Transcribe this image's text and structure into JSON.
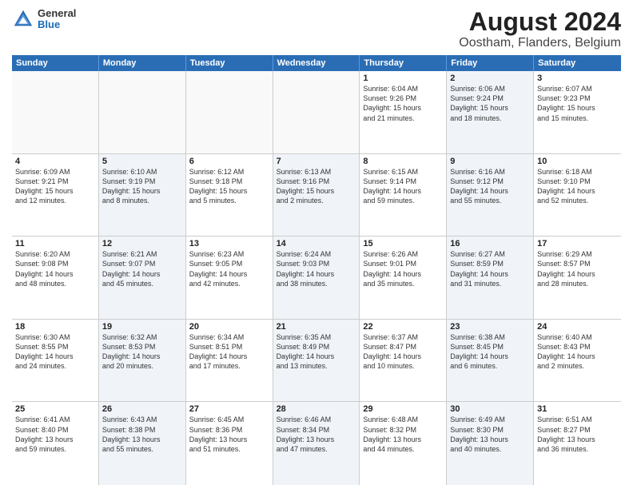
{
  "header": {
    "logo": {
      "general": "General",
      "blue": "Blue"
    },
    "title": "August 2024",
    "subtitle": "Oostham, Flanders, Belgium"
  },
  "weekdays": [
    "Sunday",
    "Monday",
    "Tuesday",
    "Wednesday",
    "Thursday",
    "Friday",
    "Saturday"
  ],
  "weeks": [
    [
      {
        "day": "",
        "info": "",
        "shaded": false,
        "empty": true
      },
      {
        "day": "",
        "info": "",
        "shaded": false,
        "empty": true
      },
      {
        "day": "",
        "info": "",
        "shaded": false,
        "empty": true
      },
      {
        "day": "",
        "info": "",
        "shaded": false,
        "empty": true
      },
      {
        "day": "1",
        "info": "Sunrise: 6:04 AM\nSunset: 9:26 PM\nDaylight: 15 hours\nand 21 minutes.",
        "shaded": false,
        "empty": false
      },
      {
        "day": "2",
        "info": "Sunrise: 6:06 AM\nSunset: 9:24 PM\nDaylight: 15 hours\nand 18 minutes.",
        "shaded": true,
        "empty": false
      },
      {
        "day": "3",
        "info": "Sunrise: 6:07 AM\nSunset: 9:23 PM\nDaylight: 15 hours\nand 15 minutes.",
        "shaded": false,
        "empty": false
      }
    ],
    [
      {
        "day": "4",
        "info": "Sunrise: 6:09 AM\nSunset: 9:21 PM\nDaylight: 15 hours\nand 12 minutes.",
        "shaded": false,
        "empty": false
      },
      {
        "day": "5",
        "info": "Sunrise: 6:10 AM\nSunset: 9:19 PM\nDaylight: 15 hours\nand 8 minutes.",
        "shaded": true,
        "empty": false
      },
      {
        "day": "6",
        "info": "Sunrise: 6:12 AM\nSunset: 9:18 PM\nDaylight: 15 hours\nand 5 minutes.",
        "shaded": false,
        "empty": false
      },
      {
        "day": "7",
        "info": "Sunrise: 6:13 AM\nSunset: 9:16 PM\nDaylight: 15 hours\nand 2 minutes.",
        "shaded": true,
        "empty": false
      },
      {
        "day": "8",
        "info": "Sunrise: 6:15 AM\nSunset: 9:14 PM\nDaylight: 14 hours\nand 59 minutes.",
        "shaded": false,
        "empty": false
      },
      {
        "day": "9",
        "info": "Sunrise: 6:16 AM\nSunset: 9:12 PM\nDaylight: 14 hours\nand 55 minutes.",
        "shaded": true,
        "empty": false
      },
      {
        "day": "10",
        "info": "Sunrise: 6:18 AM\nSunset: 9:10 PM\nDaylight: 14 hours\nand 52 minutes.",
        "shaded": false,
        "empty": false
      }
    ],
    [
      {
        "day": "11",
        "info": "Sunrise: 6:20 AM\nSunset: 9:08 PM\nDaylight: 14 hours\nand 48 minutes.",
        "shaded": false,
        "empty": false
      },
      {
        "day": "12",
        "info": "Sunrise: 6:21 AM\nSunset: 9:07 PM\nDaylight: 14 hours\nand 45 minutes.",
        "shaded": true,
        "empty": false
      },
      {
        "day": "13",
        "info": "Sunrise: 6:23 AM\nSunset: 9:05 PM\nDaylight: 14 hours\nand 42 minutes.",
        "shaded": false,
        "empty": false
      },
      {
        "day": "14",
        "info": "Sunrise: 6:24 AM\nSunset: 9:03 PM\nDaylight: 14 hours\nand 38 minutes.",
        "shaded": true,
        "empty": false
      },
      {
        "day": "15",
        "info": "Sunrise: 6:26 AM\nSunset: 9:01 PM\nDaylight: 14 hours\nand 35 minutes.",
        "shaded": false,
        "empty": false
      },
      {
        "day": "16",
        "info": "Sunrise: 6:27 AM\nSunset: 8:59 PM\nDaylight: 14 hours\nand 31 minutes.",
        "shaded": true,
        "empty": false
      },
      {
        "day": "17",
        "info": "Sunrise: 6:29 AM\nSunset: 8:57 PM\nDaylight: 14 hours\nand 28 minutes.",
        "shaded": false,
        "empty": false
      }
    ],
    [
      {
        "day": "18",
        "info": "Sunrise: 6:30 AM\nSunset: 8:55 PM\nDaylight: 14 hours\nand 24 minutes.",
        "shaded": false,
        "empty": false
      },
      {
        "day": "19",
        "info": "Sunrise: 6:32 AM\nSunset: 8:53 PM\nDaylight: 14 hours\nand 20 minutes.",
        "shaded": true,
        "empty": false
      },
      {
        "day": "20",
        "info": "Sunrise: 6:34 AM\nSunset: 8:51 PM\nDaylight: 14 hours\nand 17 minutes.",
        "shaded": false,
        "empty": false
      },
      {
        "day": "21",
        "info": "Sunrise: 6:35 AM\nSunset: 8:49 PM\nDaylight: 14 hours\nand 13 minutes.",
        "shaded": true,
        "empty": false
      },
      {
        "day": "22",
        "info": "Sunrise: 6:37 AM\nSunset: 8:47 PM\nDaylight: 14 hours\nand 10 minutes.",
        "shaded": false,
        "empty": false
      },
      {
        "day": "23",
        "info": "Sunrise: 6:38 AM\nSunset: 8:45 PM\nDaylight: 14 hours\nand 6 minutes.",
        "shaded": true,
        "empty": false
      },
      {
        "day": "24",
        "info": "Sunrise: 6:40 AM\nSunset: 8:43 PM\nDaylight: 14 hours\nand 2 minutes.",
        "shaded": false,
        "empty": false
      }
    ],
    [
      {
        "day": "25",
        "info": "Sunrise: 6:41 AM\nSunset: 8:40 PM\nDaylight: 13 hours\nand 59 minutes.",
        "shaded": false,
        "empty": false
      },
      {
        "day": "26",
        "info": "Sunrise: 6:43 AM\nSunset: 8:38 PM\nDaylight: 13 hours\nand 55 minutes.",
        "shaded": true,
        "empty": false
      },
      {
        "day": "27",
        "info": "Sunrise: 6:45 AM\nSunset: 8:36 PM\nDaylight: 13 hours\nand 51 minutes.",
        "shaded": false,
        "empty": false
      },
      {
        "day": "28",
        "info": "Sunrise: 6:46 AM\nSunset: 8:34 PM\nDaylight: 13 hours\nand 47 minutes.",
        "shaded": true,
        "empty": false
      },
      {
        "day": "29",
        "info": "Sunrise: 6:48 AM\nSunset: 8:32 PM\nDaylight: 13 hours\nand 44 minutes.",
        "shaded": false,
        "empty": false
      },
      {
        "day": "30",
        "info": "Sunrise: 6:49 AM\nSunset: 8:30 PM\nDaylight: 13 hours\nand 40 minutes.",
        "shaded": true,
        "empty": false
      },
      {
        "day": "31",
        "info": "Sunrise: 6:51 AM\nSunset: 8:27 PM\nDaylight: 13 hours\nand 36 minutes.",
        "shaded": false,
        "empty": false
      }
    ]
  ]
}
